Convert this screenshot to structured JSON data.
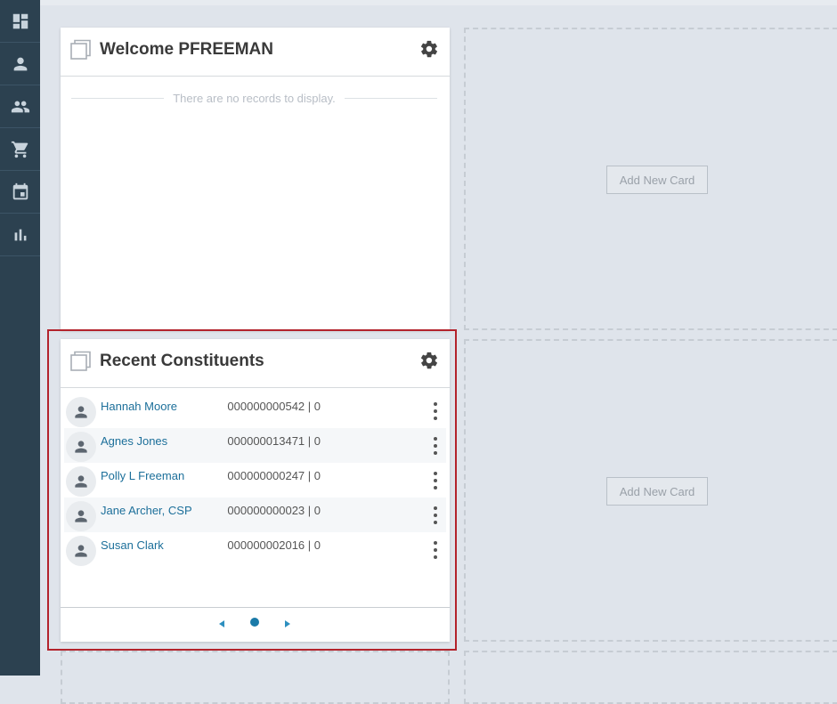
{
  "sidebar": {
    "items": [
      {
        "icon": "dashboard-icon"
      },
      {
        "icon": "person-icon"
      },
      {
        "icon": "people-icon"
      },
      {
        "icon": "cart-icon"
      },
      {
        "icon": "calendar-icon"
      },
      {
        "icon": "bar-chart-icon"
      }
    ]
  },
  "welcome_card": {
    "title": "Welcome PFREEMAN",
    "empty_message": "There are no records to display."
  },
  "add_card": {
    "label_top": "Add New Card",
    "label_bottom": "Add New Card"
  },
  "recent_card": {
    "title": "Recent Constituents",
    "rows": [
      {
        "name": "Hannah Moore",
        "lookup": "000000000542 | 0"
      },
      {
        "name": "Agnes Jones",
        "lookup": "000000013471 | 0"
      },
      {
        "name": "Polly L Freeman",
        "lookup": "000000000247 | 0"
      },
      {
        "name": "Jane Archer, CSP",
        "lookup": "000000000023 | 0"
      },
      {
        "name": "Susan Clark",
        "lookup": "000000002016 | 0"
      }
    ]
  },
  "colors": {
    "sidebar": "#2c4150",
    "link": "#1c6f9a",
    "highlight": "#b3232c",
    "background": "#dfe4eb"
  }
}
